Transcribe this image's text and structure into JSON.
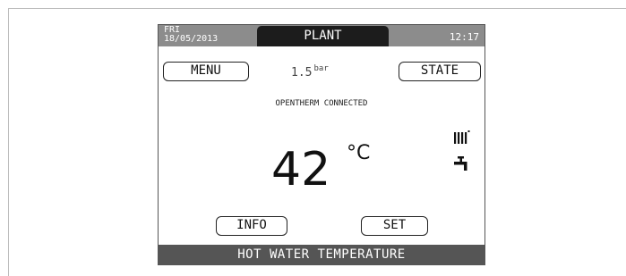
{
  "header": {
    "day": "FRI",
    "date": "18/05/2013",
    "title": "PLANT",
    "time": "12:17"
  },
  "buttons": {
    "menu": "MENU",
    "state": "STATE",
    "info": "INFO",
    "set": "SET"
  },
  "pressure": {
    "value": "1.5",
    "unit": "bar"
  },
  "status": "OPENTHERM CONNECTED",
  "temperature": {
    "value": "42",
    "unit": "°C"
  },
  "icons": [
    "radiator-icon",
    "tap-icon"
  ],
  "footer": "HOT WATER TEMPERATURE"
}
